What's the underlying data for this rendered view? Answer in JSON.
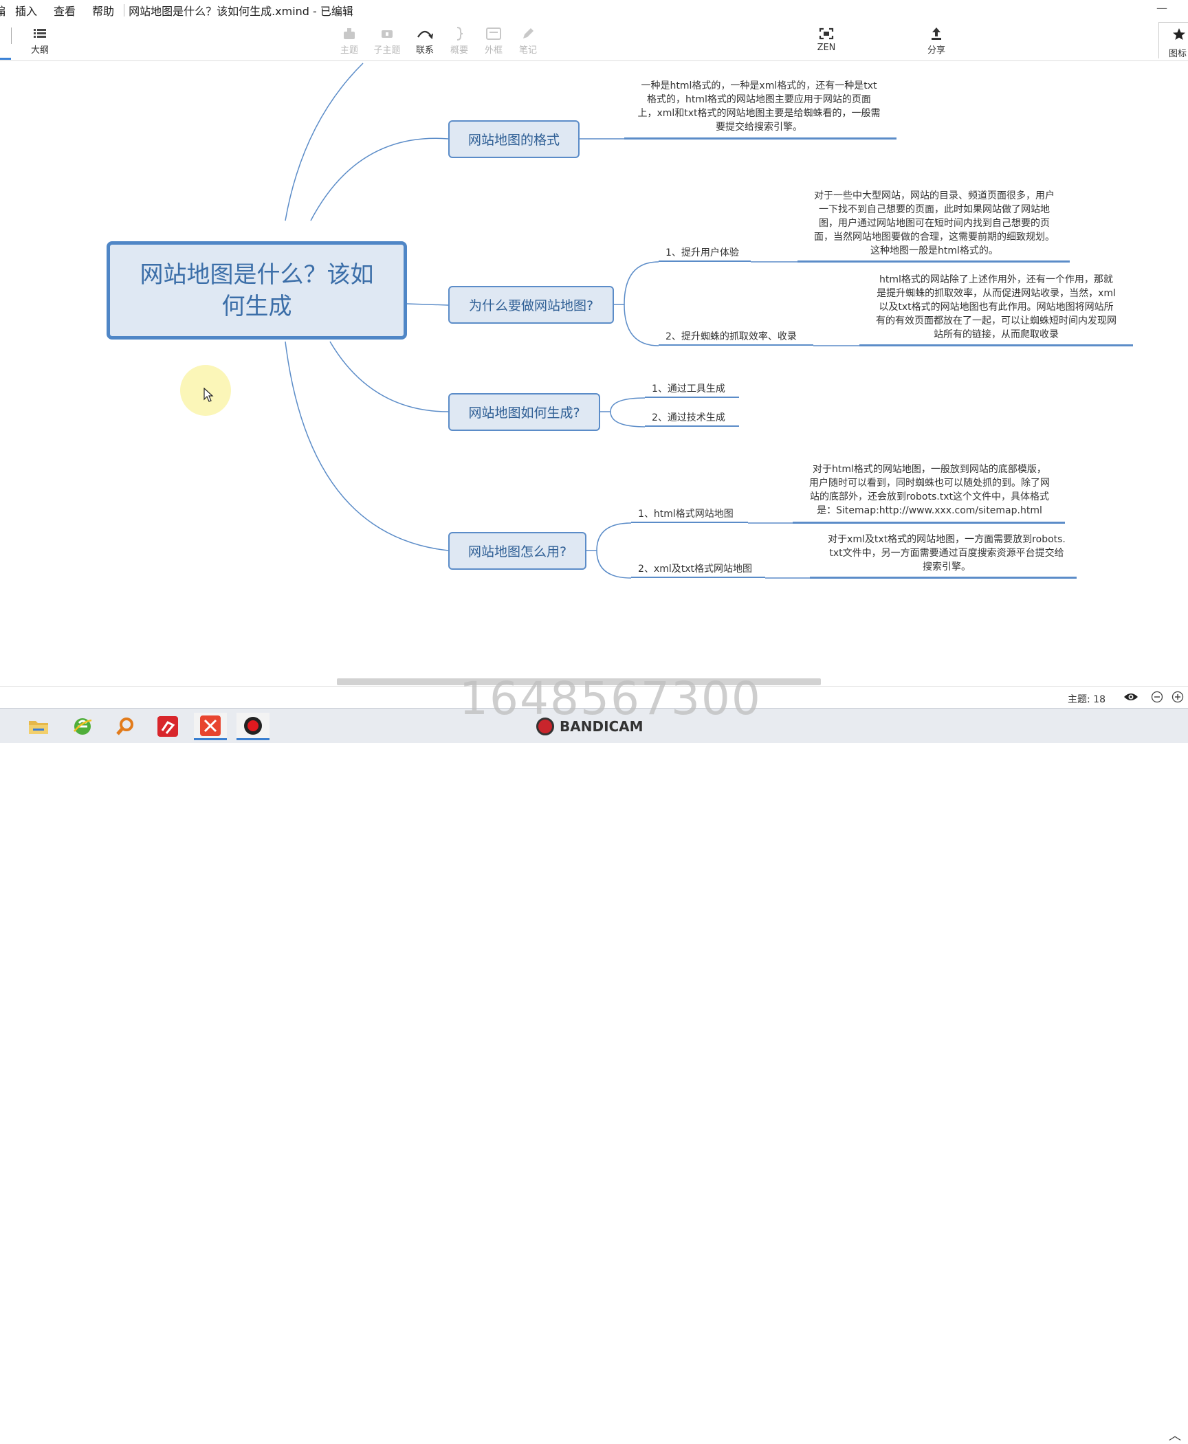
{
  "menu": {
    "partial_item": "编",
    "items": [
      "插入",
      "查看",
      "帮助"
    ],
    "window_title": "网站地图是什么？该如何生成.xmind - 已编辑"
  },
  "toolbar": {
    "outline": "大纲",
    "topic": "主题",
    "subtopic": "子主题",
    "relationship": "联系",
    "summary": "概要",
    "boundary": "外框",
    "note": "笔记",
    "zen": "ZEN",
    "share": "分享",
    "icons_partial": "图标"
  },
  "mindmap": {
    "central": "网站地图是什么？该如何生成",
    "branches": {
      "format": {
        "label": "网站地图的格式",
        "note": [
          "一种是html格式的，一种是xml格式的，还有一种是txt",
          "格式的，html格式的网站地图主要应用于网站的页面",
          "上，xml和txt格式的网站地图主要是给蜘蛛看的，一般需",
          "要提交给搜索引擎。"
        ]
      },
      "why": {
        "label": "为什么要做网站地图?",
        "children": [
          {
            "label": "1、提升用户体验",
            "note": [
              "对于一些中大型网站，网站的目录、频道页面很多，用户",
              "一下找不到自己想要的页面，此时如果网站做了网站地",
              "图，用户通过网站地图可在短时间内找到自己想要的页",
              "面，当然网站地图要做的合理，这需要前期的细致规划。",
              "这种地图一般是html格式的。"
            ]
          },
          {
            "label": "2、提升蜘蛛的抓取效率、收录",
            "note": [
              "html格式的网站除了上述作用外，还有一个作用，那就",
              "是提升蜘蛛的抓取效率，从而促进网站收录，当然，xml",
              "以及txt格式的网站地图也有此作用。网站地图将网站所",
              "有的有效页面都放在了一起，可以让蜘蛛短时间内发现网",
              "站所有的链接，从而爬取收录"
            ]
          }
        ]
      },
      "how": {
        "label": "网站地图如何生成?",
        "children": [
          {
            "label": "1、通过工具生成"
          },
          {
            "label": "2、通过技术生成"
          }
        ]
      },
      "use": {
        "label": "网站地图怎么用?",
        "children": [
          {
            "label": "1、html格式网站地图",
            "note": [
              "对于html格式的网站地图，一般放到网站的底部模版，",
              "用户随时可以看到，同时蜘蛛也可以随处抓的到。除了网",
              "站的底部外，还会放到robots.txt这个文件中，具体格式",
              "是：Sitemap:http://www.xxx.com/sitemap.html"
            ]
          },
          {
            "label": "2、xml及txt格式网站地图",
            "note": [
              "对于xml及txt格式的网站地图，一方面需要放到robots.",
              "txt文件中，另一方面需要通过百度搜索资源平台提交给",
              "搜索引擎。"
            ]
          }
        ]
      }
    }
  },
  "status": {
    "topic_count": "主题: 18"
  },
  "overlay": {
    "recording_number": "1648567300",
    "recorder_brand": "BANDICAM"
  },
  "colors": {
    "branch_line": "#5b8cc8",
    "node_fill": "#dfe8f3",
    "node_text": "#2f5f95"
  }
}
